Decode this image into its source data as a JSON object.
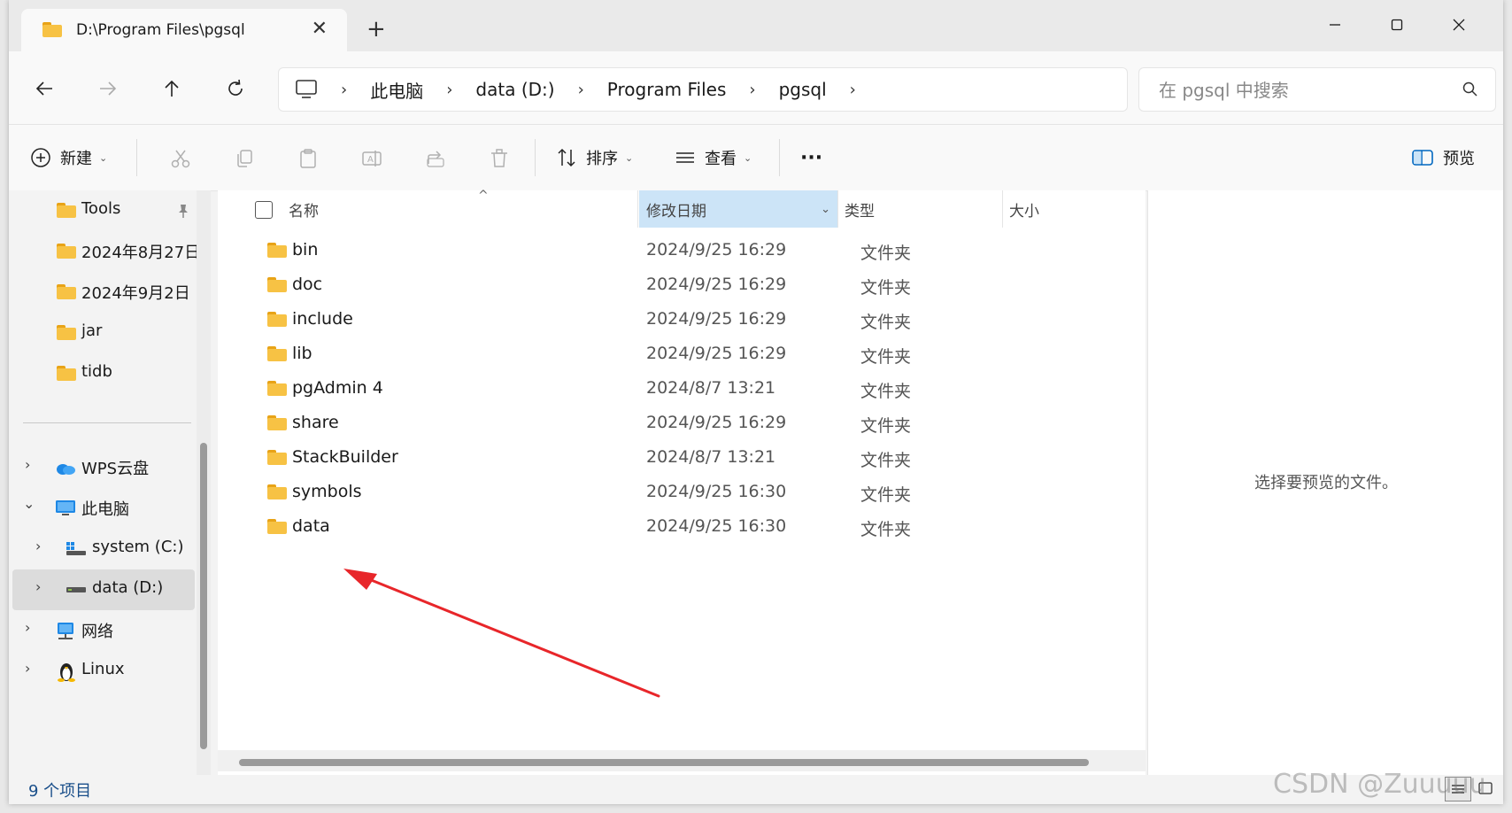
{
  "window": {
    "tab_title": "D:\\Program Files\\pgsql",
    "new_tab": "+"
  },
  "breadcrumbs": [
    "此电脑",
    "data (D:)",
    "Program Files",
    "pgsql"
  ],
  "breadcrumb_sep": "›",
  "search": {
    "placeholder": "在 pgsql 中搜索"
  },
  "toolbar": {
    "new_label": "新建",
    "sort_label": "排序",
    "view_label": "查看",
    "more_label": "···",
    "preview_label": "预览",
    "dropdown_glyph": "⌄"
  },
  "nav": {
    "quick_access": [
      {
        "label": "Tools",
        "pinned": true
      },
      {
        "label": "2024年8月27日"
      },
      {
        "label": "2024年9月2日"
      },
      {
        "label": "jar"
      },
      {
        "label": "tidb"
      }
    ],
    "tree": [
      {
        "label": "WPS云盘",
        "icon": "cloud-icon",
        "chevron": "›"
      },
      {
        "label": "此电脑",
        "icon": "computer-icon",
        "chevron": "⌄"
      },
      {
        "label": "system (C:)",
        "icon": "drive-c-icon",
        "chevron": "›"
      },
      {
        "label": "data (D:)",
        "icon": "drive-d-icon",
        "chevron": "›",
        "selected": true
      },
      {
        "label": "网络",
        "icon": "network-icon",
        "chevron": "›"
      },
      {
        "label": "Linux",
        "icon": "linux-icon",
        "chevron": "›"
      }
    ]
  },
  "columns": {
    "name": "名称",
    "date": "修改日期",
    "type": "类型",
    "size": "大小",
    "sort_caret": "^",
    "date_dropdown": "⌄"
  },
  "files": [
    {
      "name": "bin",
      "date": "2024/9/25 16:29",
      "type": "文件夹"
    },
    {
      "name": "doc",
      "date": "2024/9/25 16:29",
      "type": "文件夹"
    },
    {
      "name": "include",
      "date": "2024/9/25 16:29",
      "type": "文件夹"
    },
    {
      "name": "lib",
      "date": "2024/9/25 16:29",
      "type": "文件夹"
    },
    {
      "name": "pgAdmin 4",
      "date": "2024/8/7 13:21",
      "type": "文件夹"
    },
    {
      "name": "share",
      "date": "2024/9/25 16:29",
      "type": "文件夹"
    },
    {
      "name": "StackBuilder",
      "date": "2024/8/7 13:21",
      "type": "文件夹"
    },
    {
      "name": "symbols",
      "date": "2024/9/25 16:30",
      "type": "文件夹"
    },
    {
      "name": "data",
      "date": "2024/9/25 16:30",
      "type": "文件夹"
    }
  ],
  "preview": {
    "message": "选择要预览的文件。"
  },
  "status": {
    "item_count": "9 个项目"
  },
  "watermark": "CSDN @Zuuuuu",
  "colors": {
    "accent": "#0067c0",
    "selected_header": "#cce4f7",
    "folder": "#f7c244",
    "annotation_arrow": "#e8262a"
  }
}
